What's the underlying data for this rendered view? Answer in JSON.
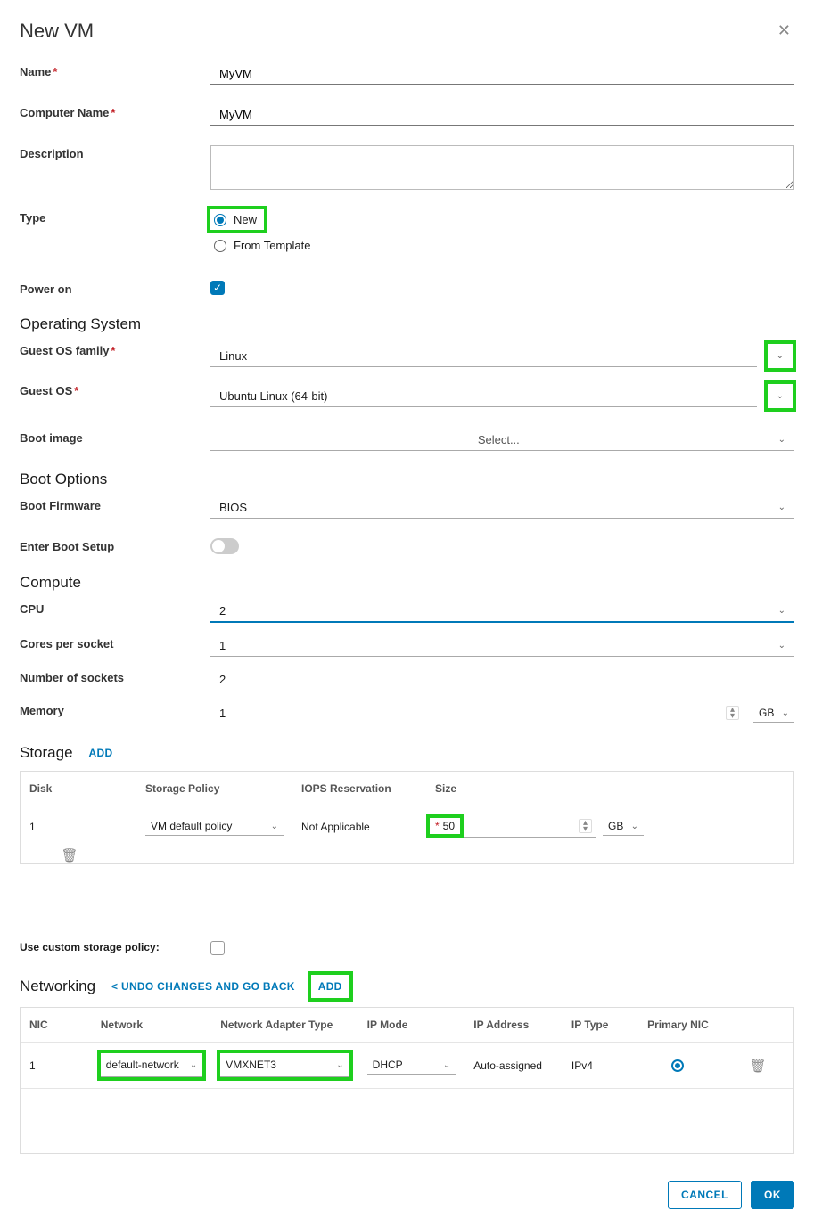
{
  "dialog": {
    "title": "New VM"
  },
  "fields": {
    "name": {
      "label": "Name",
      "value": "MyVM"
    },
    "computer_name": {
      "label": "Computer Name",
      "value": "MyVM"
    },
    "description": {
      "label": "Description",
      "value": ""
    },
    "type": {
      "label": "Type",
      "options": {
        "new": "New",
        "from_template": "From Template"
      },
      "selected": "new"
    },
    "power_on": {
      "label": "Power on",
      "checked": true
    }
  },
  "os": {
    "section": "Operating System",
    "family": {
      "label": "Guest OS family",
      "value": "Linux"
    },
    "guest_os": {
      "label": "Guest OS",
      "value": "Ubuntu Linux (64-bit)"
    },
    "boot_image": {
      "label": "Boot image",
      "placeholder": "Select..."
    }
  },
  "boot": {
    "section": "Boot Options",
    "firmware": {
      "label": "Boot Firmware",
      "value": "BIOS"
    },
    "enter_setup": {
      "label": "Enter Boot Setup",
      "on": false
    }
  },
  "compute": {
    "section": "Compute",
    "cpu": {
      "label": "CPU",
      "value": "2"
    },
    "cores_per_socket": {
      "label": "Cores per socket",
      "value": "1"
    },
    "num_sockets": {
      "label": "Number of sockets",
      "value": "2"
    },
    "memory": {
      "label": "Memory",
      "value": "1",
      "unit": "GB"
    }
  },
  "storage": {
    "section": "Storage",
    "add": "ADD",
    "headers": {
      "disk": "Disk",
      "policy": "Storage Policy",
      "iops": "IOPS Reservation",
      "size": "Size"
    },
    "rows": [
      {
        "disk": "1",
        "policy": "VM default policy",
        "iops": "Not Applicable",
        "size": "50",
        "unit": "GB"
      }
    ],
    "custom_policy": {
      "label": "Use custom storage policy:",
      "checked": false
    }
  },
  "networking": {
    "section": "Networking",
    "undo": "< UNDO CHANGES AND GO BACK",
    "add": "ADD",
    "headers": {
      "nic": "NIC",
      "network": "Network",
      "adapter": "Network Adapter Type",
      "mode": "IP Mode",
      "addr": "IP Address",
      "type": "IP Type",
      "primary": "Primary NIC"
    },
    "rows": [
      {
        "nic": "1",
        "network": "default-network",
        "adapter": "VMXNET3",
        "mode": "DHCP",
        "addr": "Auto-assigned",
        "type": "IPv4",
        "primary": true
      }
    ]
  },
  "footer": {
    "cancel": "CANCEL",
    "ok": "OK"
  }
}
